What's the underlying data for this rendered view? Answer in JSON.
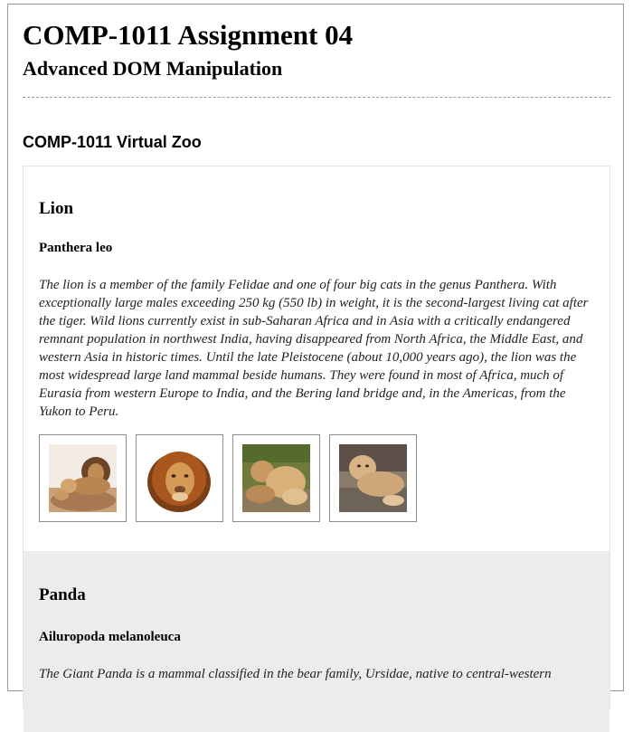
{
  "header": {
    "title": "COMP-1011 Assignment 04",
    "subtitle": "Advanced DOM Manipulation"
  },
  "zoo": {
    "heading": "COMP-1011 Virtual Zoo",
    "animals": [
      {
        "name": "Lion",
        "scientific_name": "Panthera leo",
        "description": "The lion is a member of the family Felidae and one of four big cats in the genus Panthera. With exceptionally large males exceeding 250 kg (550 lb) in weight, it is the second-largest living cat after the tiger. Wild lions currently exist in sub-Saharan Africa and in Asia with a critically endangered remnant population in northwest India, having disappeared from North Africa, the Middle East, and western Asia in historic times. Until the late Pleistocene (about 10,000 years ago), the lion was the most widespread large land mammal beside humans. They were found in most of Africa, much of Eurasia from western Europe to India, and the Bering land bridge and, in the Americas, from the Yukon to Peru.",
        "images": [
          "lion-family-photo",
          "lion-male-portrait-photo",
          "lioness-with-cubs-photo",
          "lion-cub-on-log-photo"
        ]
      },
      {
        "name": "Panda",
        "scientific_name": "Ailuropoda melanoleuca",
        "description": "The Giant Panda is a mammal classified in the bear family, Ursidae, native to central-western"
      }
    ]
  }
}
